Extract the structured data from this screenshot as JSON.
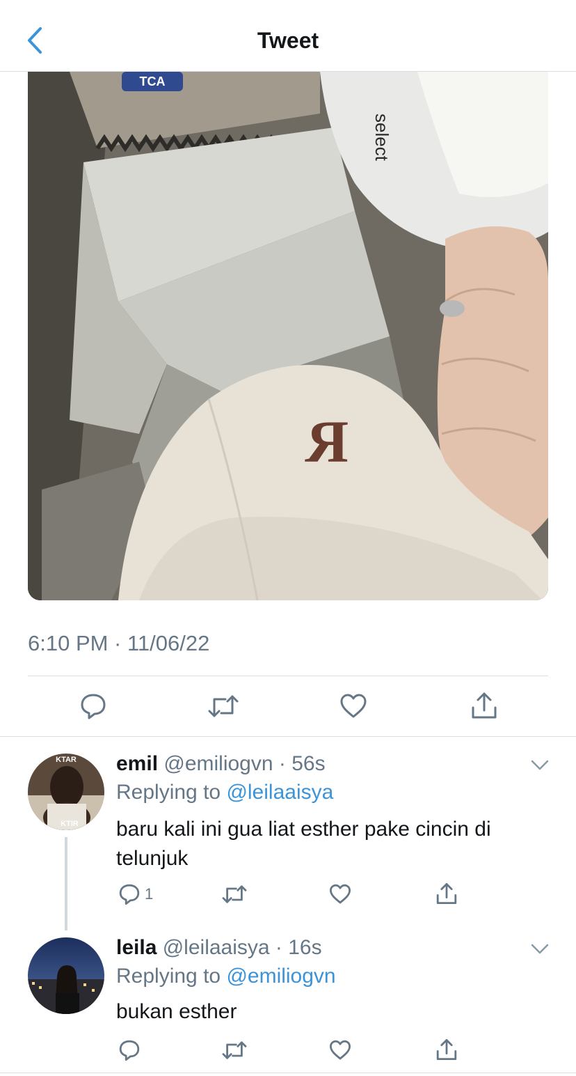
{
  "header": {
    "title": "Tweet",
    "back_icon": "chevron-left-icon"
  },
  "tweet": {
    "timestamp": "6:10 PM · 11/06/22",
    "actions": [
      "reply-icon",
      "retweet-icon",
      "like-icon",
      "share-icon"
    ],
    "photo": {
      "sign_text": "TCA",
      "cap_top_text": "select",
      "cap_logo_letter": "R"
    }
  },
  "replies": [
    {
      "name": "emil",
      "handle": "@emiliogvn",
      "time": "56s",
      "replying_prefix": "Replying to ",
      "replying_to": "@leilaaisya",
      "text": "baru kali ini gua liat esther pake cincin di telunjuk",
      "reply_count": "1",
      "avatar_text_top": "KTAR",
      "avatar_text_bottom": "KTIR"
    },
    {
      "name": "leila",
      "handle": "@leilaaisya",
      "time": "16s",
      "replying_prefix": "Replying to ",
      "replying_to": "@emiliogvn",
      "text": "bukan esther",
      "reply_count": ""
    }
  ],
  "colors": {
    "accent": "#3b94d9",
    "secondary_text": "#657786",
    "divider": "#dcdfe2"
  }
}
